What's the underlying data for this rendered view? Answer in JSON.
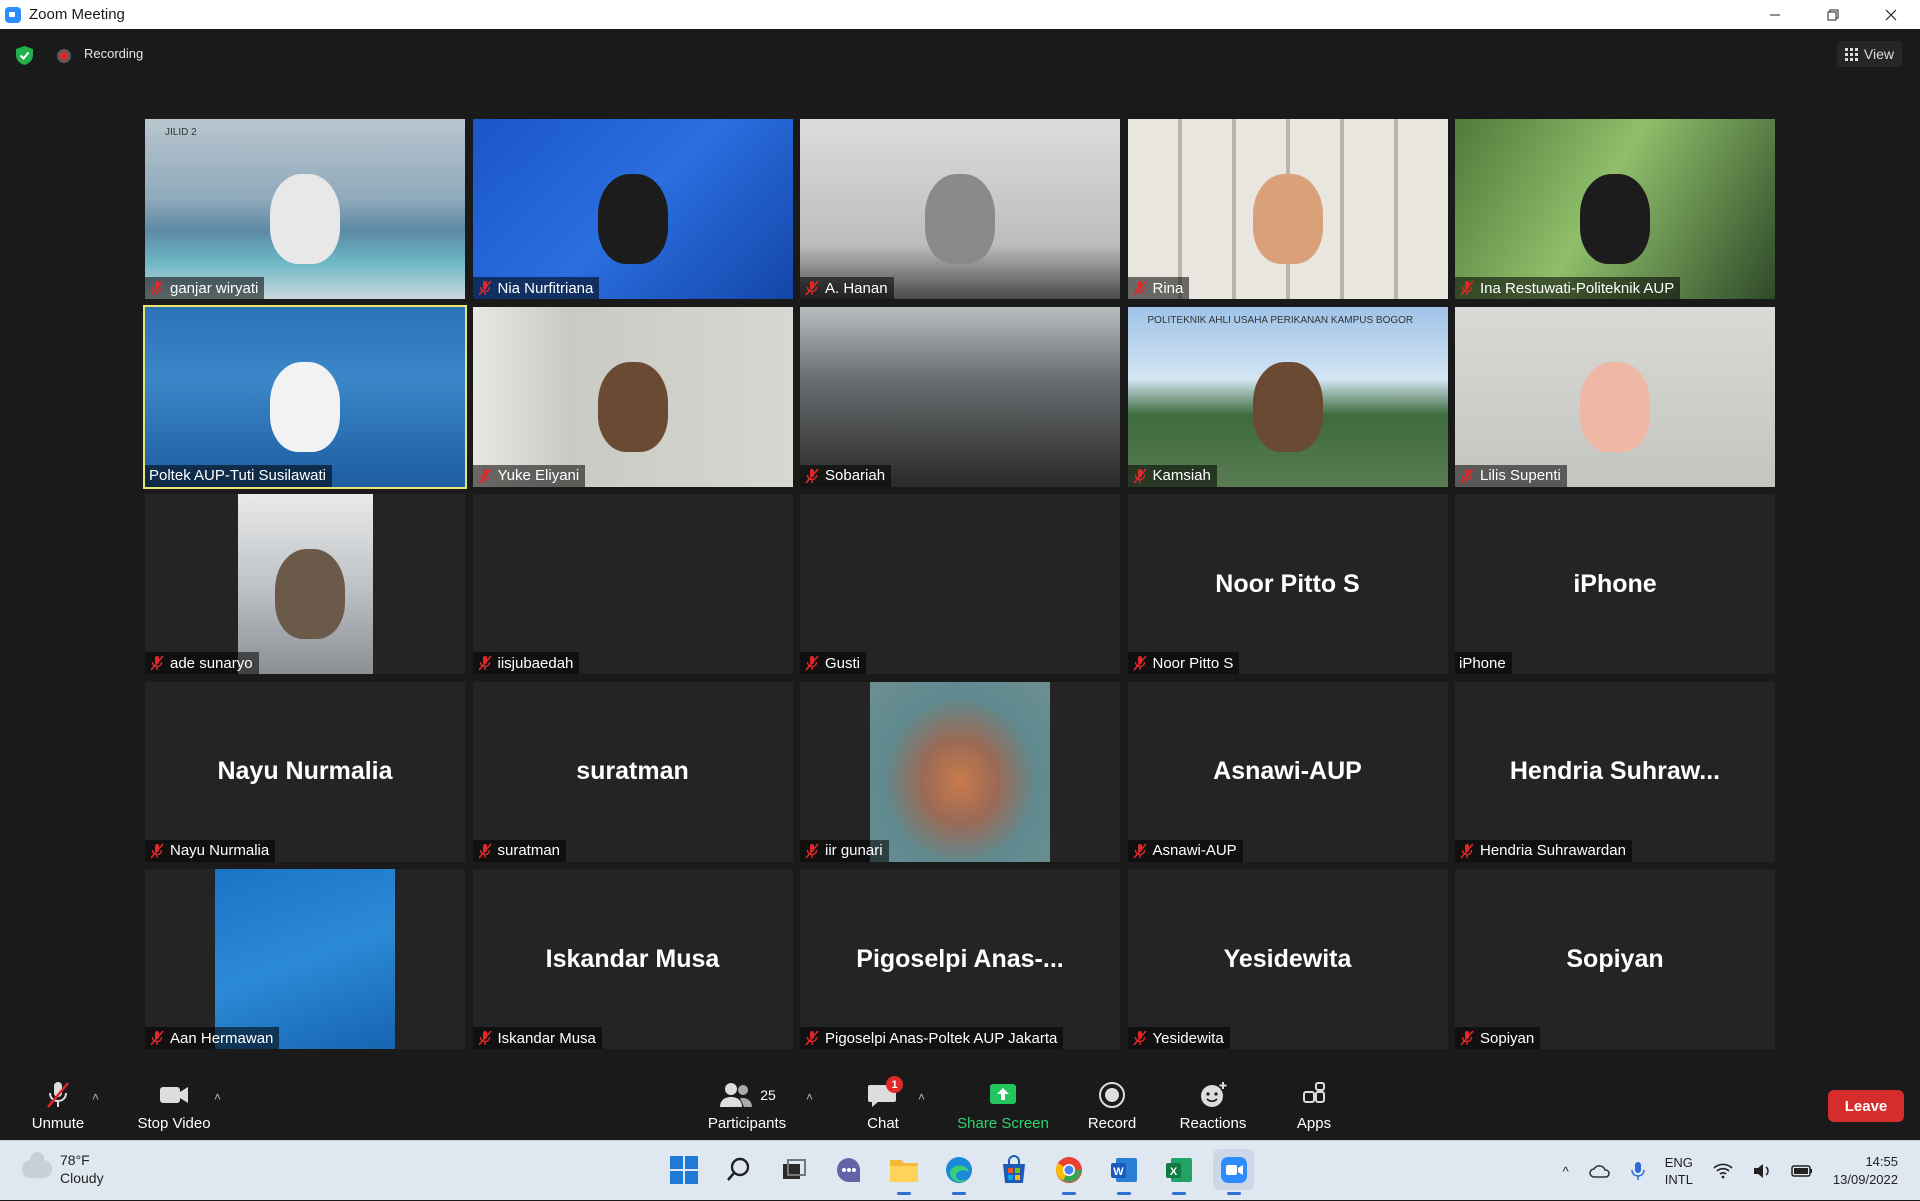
{
  "window": {
    "title": "Zoom Meeting"
  },
  "topbar": {
    "recording_label": "Recording",
    "view_label": "View"
  },
  "participants": [
    {
      "name": "ganjar wiryati",
      "photo": "beach",
      "label_text": "JILID 2"
    },
    {
      "name": "Nia Nurfitriana",
      "photo": "blue"
    },
    {
      "name": "A. Hanan",
      "photo": "wall"
    },
    {
      "name": "Rina",
      "photo": "shelf"
    },
    {
      "name": "Ina Restuwati-Politeknik AUP",
      "photo": "garden"
    },
    {
      "name": "Poltek AUP-Tuti Susilawati",
      "photo": "blur",
      "active_speaker": true,
      "muted": false
    },
    {
      "name": "Yuke Eliyani",
      "photo": "room"
    },
    {
      "name": "Sobariah",
      "photo": "dark"
    },
    {
      "name": "Kamsiah",
      "photo": "gate",
      "label_text": "POLITEKNIK AHLI USAHA PERIKANAN KAMPUS BOGOR"
    },
    {
      "name": "Lilis Supenti",
      "photo": "plain"
    },
    {
      "name": "ade sunaryo",
      "photo": "person"
    },
    {
      "name": "iisjubaedah"
    },
    {
      "name": "Gusti"
    },
    {
      "name": "Noor Pitto S",
      "display": "Noor Pitto S"
    },
    {
      "name": "iPhone",
      "display": "iPhone",
      "muted": false
    },
    {
      "name": "Nayu Nurmalia",
      "display": "Nayu Nurmalia"
    },
    {
      "name": "suratman",
      "display": "suratman"
    },
    {
      "name": "iir gunari",
      "photo": "fish"
    },
    {
      "name": "Asnawi-AUP",
      "display": "Asnawi-AUP"
    },
    {
      "name": "Hendria Suhrawardan",
      "display": "Hendria  Suhraw..."
    },
    {
      "name": "Aan Hermawan",
      "photo": "slide"
    },
    {
      "name": "Iskandar Musa",
      "display": "Iskandar Musa"
    },
    {
      "name": "Pigoselpi Anas-Poltek AUP Jakarta",
      "display": "Pigoselpi  Anas-..."
    },
    {
      "name": "Yesidewita",
      "display": "Yesidewita"
    },
    {
      "name": "Sopiyan",
      "display": "Sopiyan"
    }
  ],
  "toolbar": {
    "unmute": "Unmute",
    "stop_video": "Stop Video",
    "participants": "Participants",
    "participants_count": "25",
    "chat": "Chat",
    "chat_badge": "1",
    "share_screen": "Share Screen",
    "record": "Record",
    "reactions": "Reactions",
    "apps": "Apps",
    "leave": "Leave"
  },
  "taskbar": {
    "temperature": "78°F",
    "weather": "Cloudy",
    "language_top": "ENG",
    "language_bottom": "INTL",
    "time": "14:55",
    "date": "13/09/2022"
  },
  "colors": {
    "active_speaker_border": "#e8e56e",
    "share_screen": "#00c853",
    "leave": "#d72c2c",
    "muted_icon": "#e02828"
  }
}
